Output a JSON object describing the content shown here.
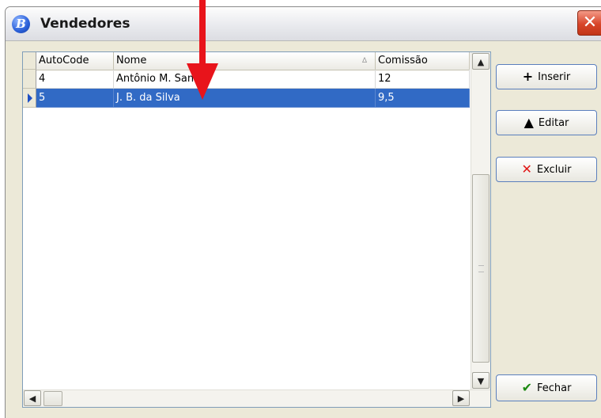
{
  "window": {
    "title": "Vendedores",
    "app_icon_letter": "B",
    "close_symbol": "✕"
  },
  "grid": {
    "columns": [
      {
        "label": "AutoCode"
      },
      {
        "label": "Nome",
        "sort_indicator": "∆"
      },
      {
        "label": "Comissão"
      }
    ],
    "rows": [
      {
        "autocode": "4",
        "nome": "Antônio M. Santos",
        "comissao": "12",
        "selected": false
      },
      {
        "autocode": "5",
        "nome": "J. B. da Silva",
        "comissao": "9,5",
        "selected": true
      }
    ]
  },
  "scrollbars": {
    "up": "▲",
    "down": "▼",
    "left": "◀",
    "right": "▶"
  },
  "buttons": {
    "inserir": {
      "icon": "+",
      "label": "Inserir"
    },
    "editar": {
      "icon": "▲",
      "label": "Editar"
    },
    "excluir": {
      "icon": "✕",
      "label": "Excluir"
    },
    "fechar": {
      "icon": "✔",
      "label": "Fechar"
    }
  },
  "colors": {
    "selection": "#316ac5",
    "annotation_arrow": "#e8141b"
  }
}
